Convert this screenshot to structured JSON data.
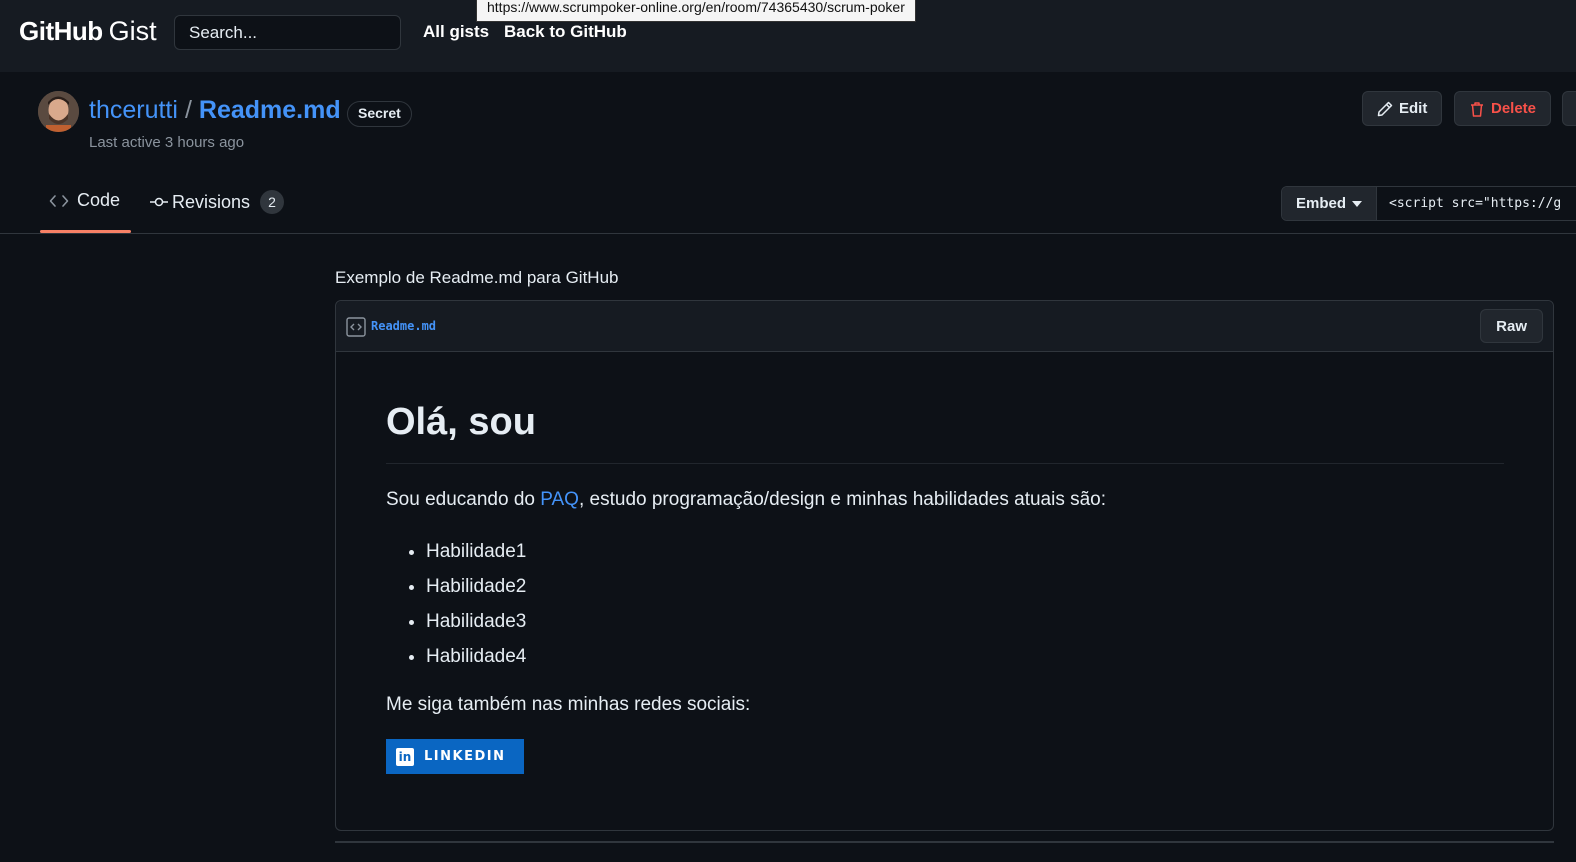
{
  "header": {
    "logo_github": "GitHub",
    "logo_gist": "Gist",
    "search_placeholder": "Search...",
    "nav": [
      "All gists",
      "Back to GitHub"
    ],
    "tooltip_url": "https://www.scrumpoker-online.org/en/room/74365430/scrum-poker"
  },
  "gist": {
    "owner": "thcerutti",
    "separator": "/",
    "filename": "Readme.md",
    "visibility_badge": "Secret",
    "last_active": "Last active 3 hours ago",
    "actions": {
      "edit": "Edit",
      "delete": "Delete"
    }
  },
  "tabs": {
    "code": "Code",
    "revisions": "Revisions",
    "revisions_count": "2"
  },
  "embed": {
    "label": "Embed",
    "value": "<script src=\"https://g"
  },
  "description": "Exemplo de Readme.md para GitHub",
  "file": {
    "name": "Readme.md",
    "raw_label": "Raw"
  },
  "readme": {
    "heading": "Olá, sou",
    "intro_before": "Sou educando do ",
    "intro_link": "PAQ",
    "intro_after": ", estudo programação/design e minhas habilidades atuais são:",
    "skills": [
      "Habilidade1",
      "Habilidade2",
      "Habilidade3",
      "Habilidade4"
    ],
    "social_text": "Me siga também nas minhas redes sociais:",
    "linkedin_badge": "LINKEDIN",
    "linkedin_icon_text": "in"
  },
  "colors": {
    "background": "#0d1117",
    "header_bg": "#161b22",
    "link": "#4493f8",
    "danger": "#f85149",
    "tab_active": "#f78166",
    "linkedin": "#0a66c2"
  }
}
